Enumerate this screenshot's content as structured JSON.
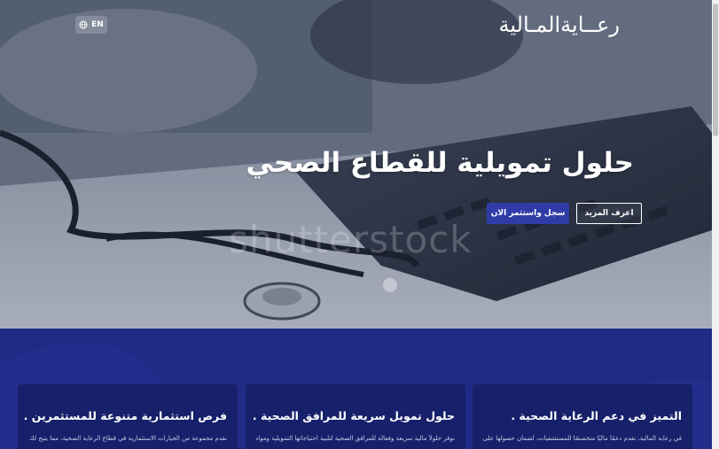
{
  "header": {
    "lang_label": "EN",
    "logo_text": "رعــايةالمـالية"
  },
  "hero": {
    "title": "حلول تمويلية للقطاع الصحي",
    "learn_more_label": "اعرف المزيد",
    "register_label": "سجل واستثمر الان",
    "watermark": "shutterstock"
  },
  "features": [
    {
      "title": "التميز في دعم الرعاية الصحية .",
      "text": "في رعاية المالية، نقدم دعمًا ماليًا متخصصًا للمستشفيات، لضمان حصولها على الموارد"
    },
    {
      "title": "حلول تمويل سريعة للمرافق الصحية .",
      "text": "نوفر حلولاً مالية سريعة وفعالة للمرافق الصحية لتلبية احتياجاتها التمويلية ومواصلة"
    },
    {
      "title": "فرص استثمارية متنوعة للمستثمرين .",
      "text": "نقدم مجموعة من الخيارات الاستثمارية في قطاع الرعاية الصحية، مما يتيح لك توسيع"
    }
  ],
  "colors": {
    "brand_blue": "#1f2b86",
    "button_blue": "#2f3ca8",
    "card_blue": "#17206a"
  }
}
